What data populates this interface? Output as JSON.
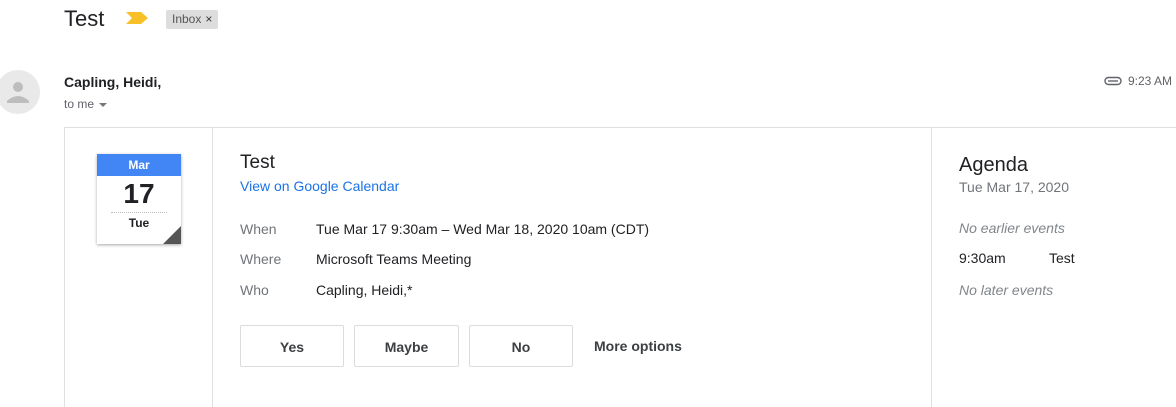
{
  "header": {
    "subject": "Test",
    "label_chip": "Inbox",
    "chip_close": "×"
  },
  "message": {
    "sender": "Capling, Heidi,",
    "recipients": "to me",
    "time": "9:23 AM"
  },
  "invite": {
    "calendar_icon": {
      "month": "Mar",
      "day": "17",
      "weekday": "Tue"
    },
    "title": "Test",
    "view_link": "View on Google Calendar",
    "details": [
      {
        "label": "When",
        "value": "Tue Mar 17 9:30am – Wed Mar 18, 2020 10am (CDT)"
      },
      {
        "label": "Where",
        "value": "Microsoft Teams Meeting"
      },
      {
        "label": "Who",
        "value": "Capling, Heidi,*"
      }
    ],
    "rsvp": {
      "yes": "Yes",
      "maybe": "Maybe",
      "no": "No",
      "more": "More options"
    }
  },
  "agenda": {
    "title": "Agenda",
    "date": "Tue Mar 17, 2020",
    "no_earlier": "No earlier events",
    "event_time": "9:30am",
    "event_title": "Test",
    "no_later": "No later events"
  },
  "colors": {
    "calendar_blue": "#4285f4",
    "link": "#1a73e8",
    "importance": "#f6c026"
  },
  "icons": [
    "importance-marker-icon",
    "chip-close-icon",
    "avatar-icon",
    "attachment-icon",
    "dropdown-caret-icon"
  ]
}
